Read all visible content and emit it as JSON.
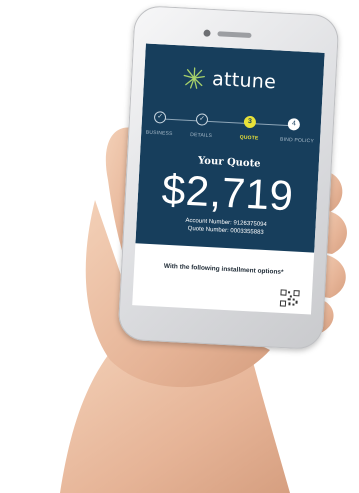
{
  "app": {
    "brand_name": "attune",
    "colors": {
      "header_bg": "#173e5c",
      "accent": "#e9e238",
      "text_light": "#ffffff"
    }
  },
  "progress": {
    "steps": [
      {
        "label": "BUSINESS",
        "state": "done",
        "icon": "check-icon"
      },
      {
        "label": "DETAILS",
        "state": "done",
        "icon": "check-icon"
      },
      {
        "label": "QUOTE",
        "state": "active",
        "icon": "number-3",
        "symbol": "3"
      },
      {
        "label": "BIND POLICY",
        "state": "todo",
        "icon": "number-4",
        "symbol": "4"
      }
    ]
  },
  "quote": {
    "title": "Your Quote",
    "amount": "$2,719",
    "account_number_line": "Account Number: 9126375094",
    "quote_number_line": "Quote Number: 0003355883"
  },
  "installments": {
    "heading": "With the following installment options*"
  }
}
